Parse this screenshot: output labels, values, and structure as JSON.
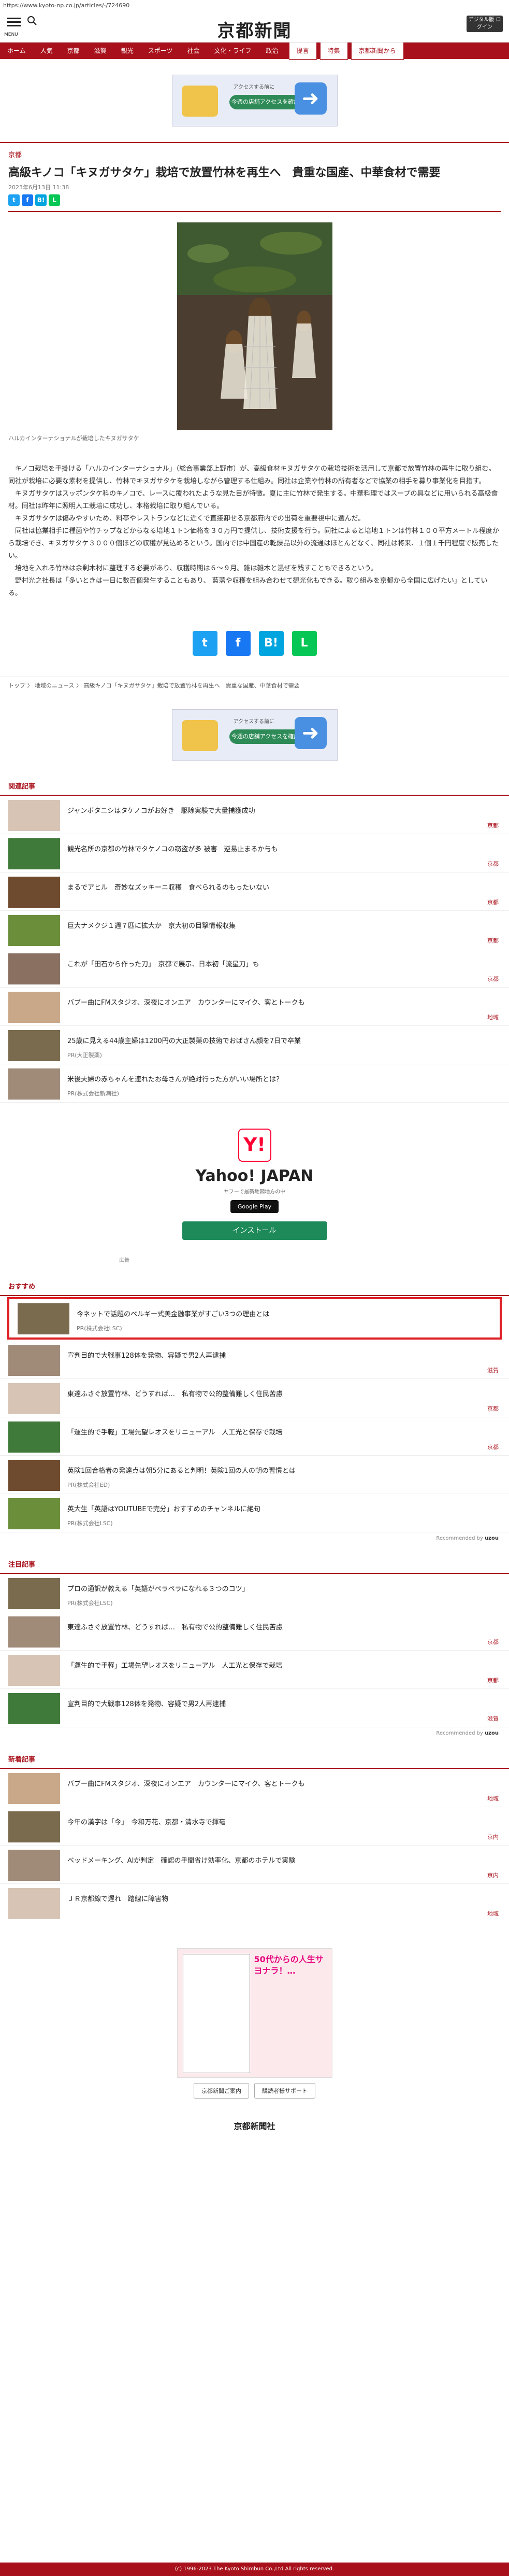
{
  "url": "https://www.kyoto-np.co.jp/articles/-/724690",
  "header": {
    "menu_label": "MENU",
    "search_label": "SEARCH",
    "logo": "京都新聞",
    "premium": "デジタル版\nログイン"
  },
  "nav": [
    "ホーム",
    "人気",
    "京都",
    "滋賀",
    "観光",
    "スポーツ",
    "社会",
    "文化・ライフ",
    "政治",
    "提言",
    "特集",
    "京都新聞から"
  ],
  "ad": {
    "text": "アクセスする前に",
    "cta": "今週の店舗アクセスを確認"
  },
  "article": {
    "kicker": "京都",
    "title": "高級キノコ「キヌガサタケ」栽培で放置竹林を再生へ　貴重な国産、中華食材で需要",
    "date": "2023年6月13日 11:38",
    "caption": "ハルカインターナショナルが栽培したキヌガサタケ",
    "paragraphs": [
      "　キノコ栽培を手掛ける「ハルカインターナショナル」（総合事業部上野市）が、高級食材キヌガサタケの栽培技術を活用して京都で放置竹林の再生に取り組む。同社が栽培に必要な素材を提供し、竹林でキヌガサタケを栽培しながら管理する仕組み。同社は企業や竹林の所有者などで協業の相手を募り事業化を目指す。",
      "　キヌガサタケはスッポンタケ科のキノコで、レースに覆われたような見た目が特徴。夏に主に竹林で発生する。中華料理ではスープの具などに用いられる高級食材。同社は昨年に照明人工栽培に成功し、本格栽培に取り組んでいる。",
      "　キヌガサタケは傷みやすいため、料亭やレストランなどに近くで直接卸せる京都府内での出荷を重要視中に選んだ。",
      "　同社は協業相手に種菌や竹チップなどからなる培地１トン価格を３０万円で提供し、技術支援を行う。同社によると培地１トンは竹林１００平方メートル程度から栽培でき、キヌガサタケ３０００個ほどの収穫が見込めるという。国内では中国産の乾燥品以外の流通はほとんどなく、同社は将来、１個１千円程度で販売したい。",
      "　培地を入れる竹林は余剰木材に整理する必要があり、収穫時期は６〜９月。雑は雑木と混ぜを残すこともできるという。",
      "　野村光之社長は「多いときは一日に数百個発生することもあり、 藍藩や収穫を組み合わせて観光化もできる。取り組みを京都から全国に広げたい」としている。"
    ],
    "breadcrumb": [
      "トップ",
      "地域のニュース",
      "高級キノコ「キヌガサタケ」栽培で放置竹林を再生へ　貴重な国産、中華食材で需要"
    ]
  },
  "related": {
    "heading": "関連記事",
    "items": [
      {
        "title": "ジャンボタニシはタケノコがお好き　駆除実験で大量捕獲成功",
        "tag": "京都"
      },
      {
        "title": "観光名所の京都の竹林でタケノコの窃盗が多 被害　逆易止まるか与も",
        "tag": "京都"
      },
      {
        "title": "まるでアヒル　奇妙なズッキーニ収穫　食べられるのもったいない",
        "tag": "京都"
      },
      {
        "title": "巨大ナメクジ１週７匹に拡大か　京大初の目撃情報収集",
        "tag": "京都"
      },
      {
        "title": "これが「田石から作った刀」　京都で展示、日本初「流星刀」も",
        "tag": "京都"
      },
      {
        "title": "バブー曲にFMスタジオ、深夜にオンエア　カウンターにマイク、客とトークも",
        "tag": "地域"
      },
      {
        "title": "25歳に見える44歳主婦は1200円の大正製薬の技術でおばさん顔を7日で卒業",
        "tag": "",
        "pr": "PR(大正製薬)"
      },
      {
        "title": "米後夫婦の赤ちゃんを連れたお母さんが絶対行った方がいい場所とは？",
        "tag": "",
        "pr": "PR(株式会社新潮社)"
      }
    ]
  },
  "yahoo": {
    "title": "Yahoo! JAPAN",
    "sub": "ヤフーで最新地図地方の中",
    "gplay": "Google Play",
    "install": "インストール",
    "admark": "広告"
  },
  "recommend": {
    "heading": "おすすめ",
    "items": [
      {
        "title": "今ネットで話題のベルギー式美金融事業がすごい3つの理由とは",
        "pr": "PR(株式会社LSC)",
        "tag": ""
      },
      {
        "title": "宣判目的で大戦事128体を発物、容疑で男2人再逮捕",
        "pr": "",
        "tag": "滋賀"
      },
      {
        "title": "東達ふさぐ放置竹林、どうすれば…　私有物で公的整備難しく住民苦慮",
        "pr": "",
        "tag": "京都"
      },
      {
        "title": "「運生的で手軽」工場先望レオスをリニューアル　人工光と保存で栽培",
        "pr": "",
        "tag": "京都"
      },
      {
        "title": "英険1回合格者の発達点は朝5分にあると判明！英険1回の人の朝の習慣とは",
        "pr": "PR(株式会社ED)",
        "tag": ""
      },
      {
        "title": "英大生「英語はYOUTUBEで完分」おすすめのチャンネルに絶句",
        "pr": "PR(株式会社LSC)",
        "tag": ""
      }
    ],
    "powered": "Recommended by"
  },
  "attention": {
    "heading": "注目記事",
    "items": [
      {
        "title": "プロの通訳が教える「英語がペラペラになれる３つのコツ」",
        "pr": "PR(株式会社LSC)",
        "tag": ""
      },
      {
        "title": "東達ふさぐ放置竹林、どうすれば…　私有物で公的整備難しく住民苦慮",
        "pr": "",
        "tag": "京都"
      },
      {
        "title": "「運生的で手軽」工場先望レオスをリニューアル　人工光と保存で栽培",
        "pr": "",
        "tag": "京都"
      },
      {
        "title": "宣判目的で大戦事128体を発物、容疑で男2人再逮捕",
        "pr": "",
        "tag": "滋賀"
      }
    ],
    "powered": "Recommended by"
  },
  "latest": {
    "heading": "新着記事",
    "items": [
      {
        "title": "バブー曲にFMスタジオ、深夜にオンエア　カウンターにマイク、客とトークも",
        "tag": "地域"
      },
      {
        "title": "今年の漢字は「今」　今和万花、京都・清水寺で揮毫",
        "tag": "京内"
      },
      {
        "title": "ベッドメーキング、AIが判定　確認の手間省け効率化、京都のホテルで実験",
        "tag": "京内"
      },
      {
        "title": "ＪＲ京都線で遅れ　踏線に障害物",
        "tag": "地域"
      }
    ]
  },
  "manga": {
    "text": "50代からの人生サヨナラ！…"
  },
  "footer": {
    "links": [
      "京都新聞ご案内",
      "購読者様サポート"
    ],
    "logo": "京都新聞社",
    "copyright": "(c) 1996-2023 The Kyoto Shimbun Co.,Ltd All rights reserved."
  },
  "colors": {
    "brand": "#a8111b",
    "highlight": "#e01e25",
    "install": "#1e8a5a"
  }
}
